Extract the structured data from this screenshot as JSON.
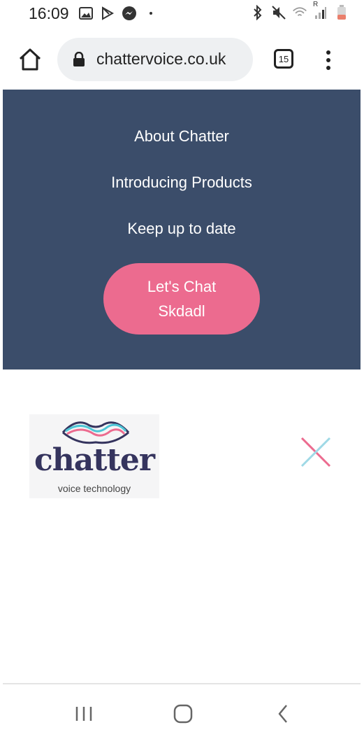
{
  "status_bar": {
    "time": "16:09",
    "left_icons": [
      "gallery-icon",
      "play-store-icon",
      "messenger-icon",
      "dot-icon"
    ],
    "right_icons": [
      "bluetooth-icon",
      "mute-icon",
      "wifi-icon",
      "signal-icon",
      "battery-icon"
    ],
    "signal_label": "R"
  },
  "browser": {
    "url": "chattervoice.co.uk",
    "tab_count": "15"
  },
  "nav_menu": {
    "items": [
      {
        "label": "About Chatter"
      },
      {
        "label": "Introducing Products"
      },
      {
        "label": "Keep up to date"
      }
    ],
    "cta_line1": "Let's Chat",
    "cta_line2": "Skdadl",
    "cta_color": "#ec6b8f",
    "background_color": "#3b4d6a"
  },
  "logo": {
    "wordmark": "chatter",
    "tagline": "voice technology"
  },
  "system_nav": {
    "buttons": [
      "recents-icon",
      "home-icon",
      "back-icon"
    ]
  }
}
